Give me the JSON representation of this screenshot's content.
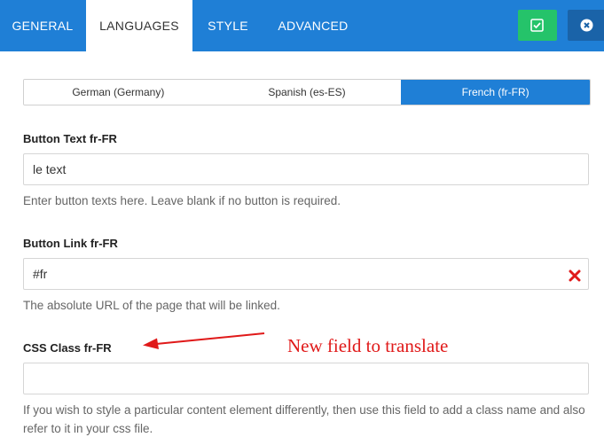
{
  "tabs": [
    {
      "label": "GENERAL"
    },
    {
      "label": "LANGUAGES"
    },
    {
      "label": "STYLE"
    },
    {
      "label": "ADVANCED"
    }
  ],
  "actions": {
    "save_icon": "check-square-icon",
    "close_icon": "close-circle-icon",
    "save_color": "#25c36a"
  },
  "languages": [
    {
      "label": "German (Germany)"
    },
    {
      "label": "Spanish (es-ES)"
    },
    {
      "label": "French (fr-FR)"
    }
  ],
  "fields": {
    "button_text": {
      "label": "Button Text fr-FR",
      "value": "le text",
      "help": "Enter button texts here. Leave blank if no button is required."
    },
    "button_link": {
      "label": "Button Link fr-FR",
      "value": "#fr",
      "help": "The absolute URL of the page that will be linked."
    },
    "css_class": {
      "label": "CSS Class fr-FR",
      "value": "",
      "help": "If you wish to style a particular content element differently, then use this field to add a class name and also refer to it in your css file."
    }
  },
  "annotation": {
    "text": "New field to translate",
    "color": "#e01919"
  },
  "colors": {
    "accent": "#1f7fd6",
    "close": "#1a63a8"
  }
}
